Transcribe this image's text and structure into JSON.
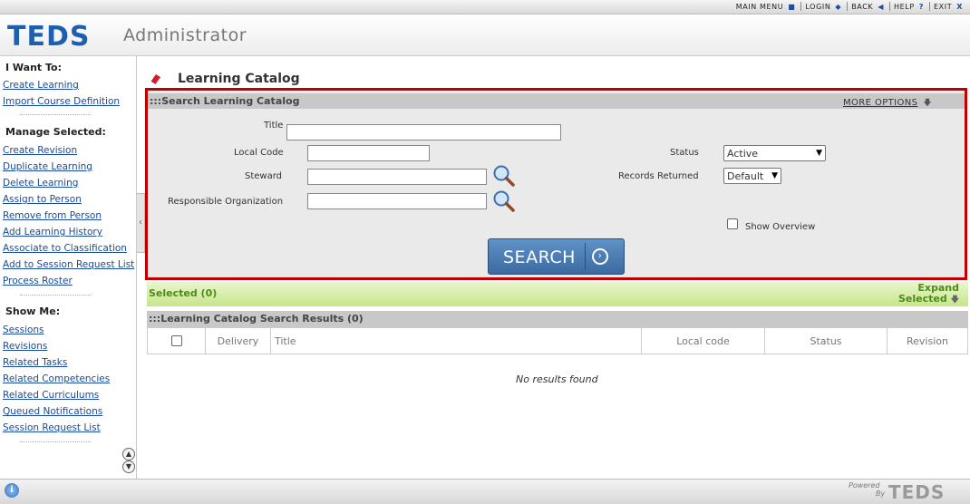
{
  "topnav": {
    "items": [
      {
        "label": "MAIN MENU",
        "icon": "stop-square-icon",
        "glyph": "■"
      },
      {
        "label": "LOGIN",
        "icon": "diamond-icon",
        "glyph": "◆"
      },
      {
        "label": "BACK",
        "icon": "back-arrow-icon",
        "glyph": "◀"
      },
      {
        "label": "HELP",
        "icon": "help-icon",
        "glyph": "?"
      },
      {
        "label": "EXIT",
        "icon": "close-icon",
        "glyph": "X"
      }
    ]
  },
  "header": {
    "logo_text": "TEDS",
    "app_title": "Administrator"
  },
  "sidebar": {
    "i_want_to": {
      "heading": "I Want To:",
      "links": [
        "Create Learning",
        "Import Course Definition"
      ]
    },
    "manage_selected": {
      "heading": "Manage Selected:",
      "links": [
        "Create Revision",
        "Duplicate Learning",
        "Delete Learning",
        "Assign to Person",
        "Remove from Person",
        "Add Learning History",
        "Associate to Classification",
        "Add to Session Request List",
        "Process Roster"
      ]
    },
    "show_me": {
      "heading": "Show Me:",
      "links": [
        "Sessions",
        "Revisions",
        "Related Tasks",
        "Related Competencies",
        "Related Curriculums",
        "Queued Notifications",
        "Session Request List"
      ]
    }
  },
  "main": {
    "page_title": "Learning Catalog",
    "search_panel": {
      "heading": ":::Search Learning Catalog",
      "more_options": "MORE OPTIONS",
      "fields": {
        "title": {
          "label": "Title",
          "value": ""
        },
        "local_code": {
          "label": "Local Code",
          "value": ""
        },
        "steward": {
          "label": "Steward",
          "value": ""
        },
        "responsible_org": {
          "label": "Responsible Organization",
          "value": ""
        },
        "status": {
          "label": "Status",
          "value": "Active"
        },
        "records_returned": {
          "label": "Records Returned",
          "value": "Default"
        },
        "show_overview": {
          "label": "Show Overview",
          "checked": false
        }
      },
      "search_button": "SEARCH"
    },
    "selected": {
      "label": "Selected (0)",
      "expand_line1": "Expand",
      "expand_line2": "Selected"
    },
    "results": {
      "heading": ":::Learning Catalog Search Results (0)",
      "columns": [
        "Delivery",
        "Title",
        "Local code",
        "Status",
        "Revision"
      ],
      "empty_message": "No results found"
    }
  },
  "footer": {
    "powered_line1": "Powered",
    "powered_line2": "By",
    "logo_text": "TEDS"
  },
  "colors": {
    "link": "#1a4a9a",
    "highlight_border": "#c00000",
    "selected_green": "#4e8a1c",
    "search_button": "#4a7db4"
  }
}
